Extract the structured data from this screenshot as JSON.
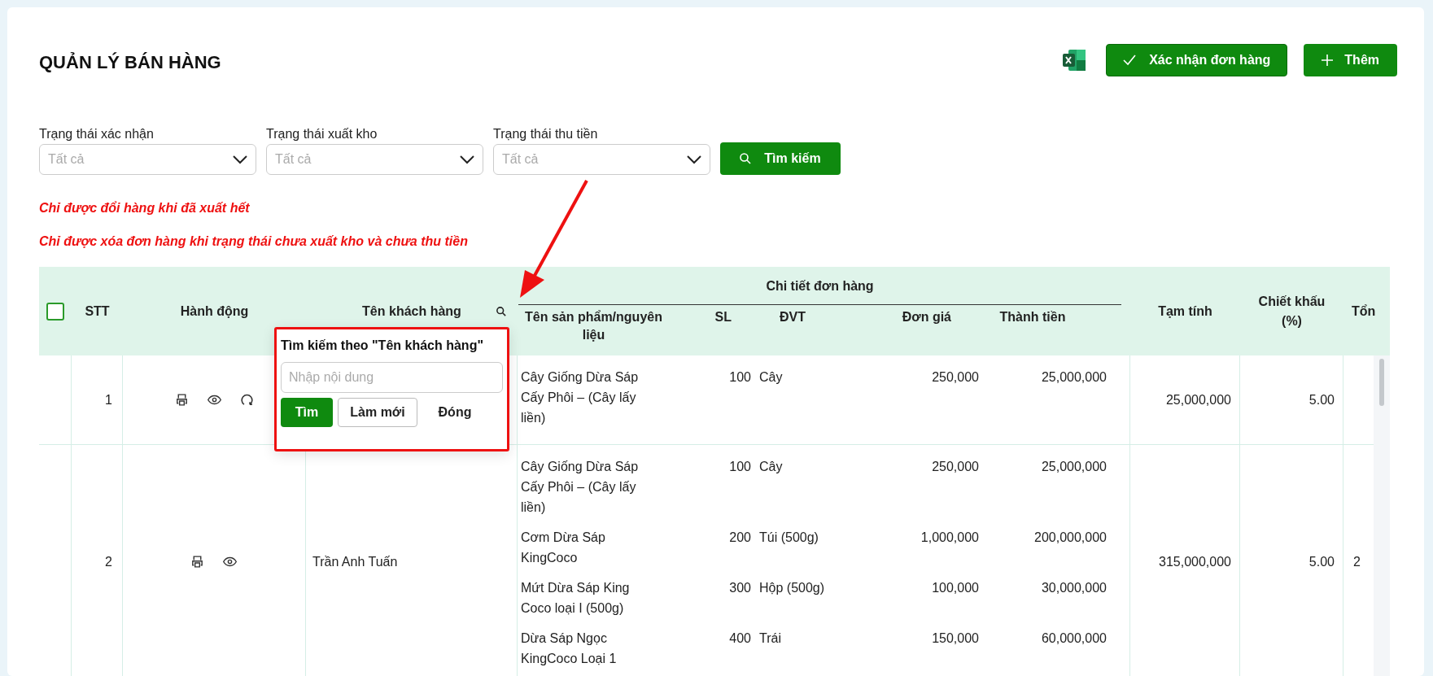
{
  "title": "QUẢN LÝ BÁN HÀNG",
  "actions": [
    {
      "kind": "excel"
    },
    {
      "kind": "confirm",
      "label": "Xác nhận đơn hàng"
    },
    {
      "kind": "add",
      "label": "Thêm"
    }
  ],
  "filters": [
    {
      "label": "Trạng thái xác nhận",
      "placeholder": "Tất cả"
    },
    {
      "label": "Trạng thái xuất kho",
      "placeholder": "Tất cả"
    },
    {
      "label": "Trạng thái thu tiền",
      "placeholder": "Tất cả"
    }
  ],
  "search_button": "Tìm kiếm",
  "notes": [
    "Chỉ được đổi hàng khi đã xuất hết",
    "Chỉ được xóa đơn hàng khi trạng thái chưa xuất kho và chưa thu tiền"
  ],
  "table": {
    "select_all_checked": false,
    "columns": {
      "stt": "STT",
      "actions": "Hành động",
      "customer": "Tên khách hàng",
      "detail": "Chi tiết đơn hàng",
      "product": "Tên sản phẩm/nguyên liệu",
      "qty": "SL",
      "unit": "ĐVT",
      "price": "Đơn giá",
      "amount": "Thành tiền",
      "subtotal": "Tạm tính",
      "discount": "Chiết khấu (%)",
      "column_9": "Tổn"
    },
    "rows": [
      {
        "stt": "1",
        "actions": [
          {
            "kind": "print"
          },
          {
            "kind": "view"
          },
          {
            "kind": "refresh"
          }
        ],
        "products": [
          {
            "name": "Cây Giống Dừa Sáp Cấy Phôi – (Cây lấy liền)",
            "qty": "100",
            "unit": "Cây",
            "price": "250,000",
            "amount": "25,000,000"
          }
        ],
        "subtotal": "25,000,000",
        "discount": "5.00"
      },
      {
        "stt": "2",
        "customer": "Trần Anh Tuấn",
        "actions": [
          {
            "kind": "print"
          },
          {
            "kind": "view"
          }
        ],
        "products": [
          {
            "name": "Cây Giống Dừa Sáp Cấy Phôi – (Cây lấy liền)",
            "qty": "100",
            "unit": "Cây",
            "price": "250,000",
            "amount": "25,000,000"
          },
          {
            "name": "Cơm Dừa Sáp KingCoco",
            "qty": "200",
            "unit": "Túi (500g)",
            "price": "1,000,000",
            "amount": "200,000,000"
          },
          {
            "name": "Mứt Dừa Sáp King Coco loại I (500g)",
            "qty": "300",
            "unit": "Hộp (500g)",
            "price": "100,000",
            "amount": "30,000,000"
          },
          {
            "name": "Dừa Sáp Ngọc KingCoco Loại 1",
            "qty": "400",
            "unit": "Trái",
            "price": "150,000",
            "amount": "60,000,000"
          }
        ],
        "subtotal": "315,000,000",
        "discount": "5.00",
        "column_9": "2"
      }
    ]
  },
  "popup": {
    "title": "Tìm kiếm theo \"Tên khách hàng\"",
    "placeholder": "Nhập nội dung",
    "buttons": [
      {
        "kind": "primary",
        "label": "Tìm"
      },
      {
        "kind": "outline",
        "label": "Làm mới"
      },
      {
        "kind": "text",
        "label": "Đóng"
      }
    ]
  }
}
